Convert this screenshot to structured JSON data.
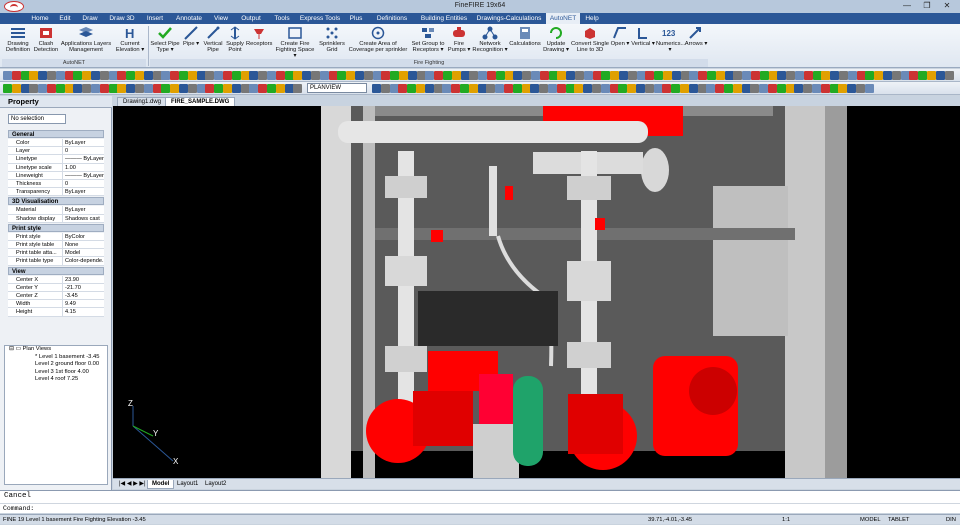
{
  "window": {
    "title": "FineFIRE 19x64",
    "min": "—",
    "max": "❐",
    "close": "✕"
  },
  "menu": [
    "Home",
    "Edit",
    "Draw",
    "Draw 3D",
    "Insert",
    "Annotate",
    "View",
    "Output",
    "Tools",
    "Express Tools",
    "Plus",
    "Definitions",
    "Building Entities",
    "Drawings-Calculations",
    "AutoNET",
    "Help"
  ],
  "menu_active": "AutoNET",
  "ribbon": {
    "autonet_buttons": [
      {
        "label": "Drawing Definition",
        "icon": "drawing-definition-icon"
      },
      {
        "label": "Clash Detection",
        "icon": "clash-detection-icon"
      },
      {
        "label": "Applications Layers Management",
        "icon": "layers-management-icon"
      },
      {
        "label": "Current Elevation ▾",
        "icon": "elevation-icon"
      }
    ],
    "autonet_group": "AutoNET",
    "fire_buttons": [
      {
        "label": "Select Pipe Type ▾",
        "icon": "select-pipe-type-icon"
      },
      {
        "label": "Pipe ▾",
        "icon": "pipe-icon"
      },
      {
        "label": "Vertical Pipe",
        "icon": "vertical-pipe-icon"
      },
      {
        "label": "Supply Point",
        "icon": "supply-point-icon"
      },
      {
        "label": "Receptors",
        "icon": "receptors-icon"
      },
      {
        "label": "Create Fire Fighting Space ▾",
        "icon": "fire-space-icon"
      },
      {
        "label": "Sprinklers Grid",
        "icon": "sprinklers-grid-icon"
      },
      {
        "label": "Create Area of Coverage per sprinkler",
        "icon": "coverage-area-icon"
      },
      {
        "label": "Set Group to Receptors ▾",
        "icon": "group-receptors-icon"
      },
      {
        "label": "Fire Pumps ▾",
        "icon": "fire-pumps-icon"
      },
      {
        "label": "Network Recognition ▾",
        "icon": "network-recognition-icon"
      },
      {
        "label": "Calculations",
        "icon": "calculations-icon"
      },
      {
        "label": "Update Drawing ▾",
        "icon": "update-drawing-icon"
      },
      {
        "label": "Convert Single Line to 3D",
        "icon": "convert-3d-icon"
      },
      {
        "label": "Open ▾",
        "icon": "open-icon"
      },
      {
        "label": "Vertical ▾",
        "icon": "vertical-icon"
      },
      {
        "label": "Numerics... ▾",
        "icon": "numerics-icon"
      },
      {
        "label": "Arrows ▾",
        "icon": "arrows-icon"
      }
    ],
    "fire_group": "Fire Fighting"
  },
  "toolbar": {
    "layer": "PLANVIEW"
  },
  "property": {
    "title": "Property",
    "selection": "No selection",
    "sections": [
      {
        "name": "General",
        "rows": [
          [
            "Color",
            "ByLayer"
          ],
          [
            "Layer",
            "0"
          ],
          [
            "Linetype",
            "——— ByLayer"
          ],
          [
            "Linetype scale",
            "1.00"
          ],
          [
            "Lineweight",
            "——— ByLayer"
          ],
          [
            "Thickness",
            "0"
          ],
          [
            "Transparency",
            "ByLayer"
          ]
        ]
      },
      {
        "name": "3D Visualisation",
        "rows": [
          [
            "Material",
            "ByLayer"
          ],
          [
            "Shadow display",
            "Shadows cast"
          ]
        ]
      },
      {
        "name": "Print style",
        "rows": [
          [
            "Print style",
            "ByColor"
          ],
          [
            "Print style table",
            "None"
          ],
          [
            "Print table atta...",
            "Model"
          ],
          [
            "Print table type",
            "Color-depende..."
          ]
        ]
      },
      {
        "name": "View",
        "rows": [
          [
            "Center X",
            "23.90"
          ],
          [
            "Center Y",
            "-21.70"
          ],
          [
            "Center Z",
            "-3.45"
          ],
          [
            "Width",
            "9.49"
          ],
          [
            "Height",
            "4.15"
          ]
        ]
      }
    ]
  },
  "tree": {
    "root": "Plan Views",
    "items": [
      "* Level 1 basement -3.45",
      "Level 2 ground floor 0.00",
      "Level 3 1st floor 4.00",
      "Level 4 roof 7.25"
    ]
  },
  "doc_tabs": [
    "Drawing1.dwg",
    "FIRE_SAMPLE.DWG"
  ],
  "doc_tab_active": "FIRE_SAMPLE.DWG",
  "layout_tabs": [
    "Model",
    "Layout1",
    "Layout2"
  ],
  "ucs": {
    "x": "X",
    "y": "Y",
    "z": "Z"
  },
  "command": {
    "line1": "Cancel",
    "line2": "Command:"
  },
  "status": {
    "left": "FINE 19 Level 1 basement Fire Fighting Elevation -3.45",
    "coords": "39.71,-4.01,-3.45",
    "scale": "1:1",
    "model": "MODEL",
    "tablet": "TABLET",
    "din": "DIN"
  },
  "colors": {
    "fire_red": "#ff0000",
    "ribbon_blue": "#2b5797",
    "canvas": "#000000"
  }
}
